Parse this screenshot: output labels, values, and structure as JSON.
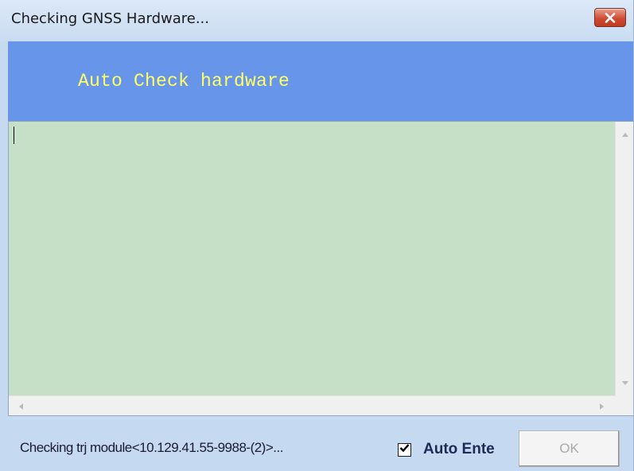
{
  "window": {
    "title": "Checking GNSS Hardware..."
  },
  "header": {
    "text": "Auto Check hardware",
    "background_color": "#6795ea",
    "text_color": "#ffff66"
  },
  "log": {
    "text": "",
    "background_color": "#c6dfc7"
  },
  "footer": {
    "status_text": "Checking trj module<10.129.41.55-9988-(2)>...",
    "auto_enter": {
      "label": "Auto Ente",
      "checked": true
    },
    "ok_label": "OK",
    "ok_enabled": false
  },
  "icons": {
    "close": "close-icon",
    "check": "checkmark-icon"
  }
}
